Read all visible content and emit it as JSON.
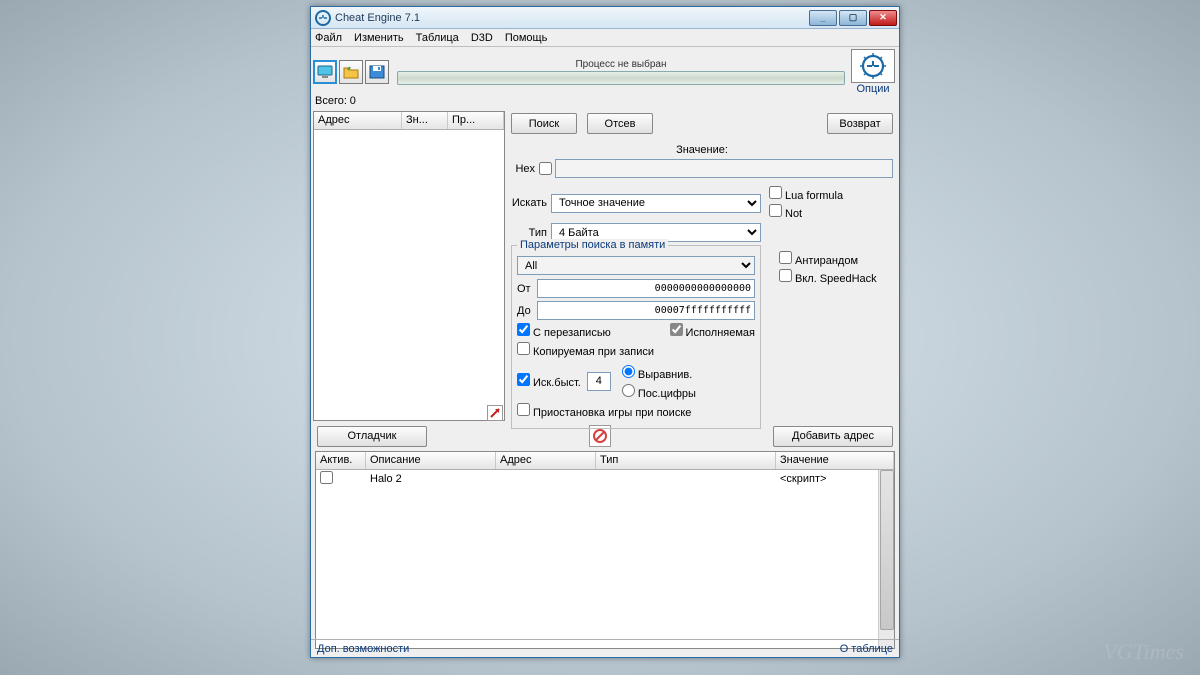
{
  "titlebar": {
    "title": "Cheat Engine 7.1"
  },
  "menu": {
    "file": "Файл",
    "edit": "Изменить",
    "table": "Таблица",
    "d3d": "D3D",
    "help": "Помощь"
  },
  "toolbar": {
    "process_status": "Процесс не выбран",
    "options": "Опции",
    "total_label": "Всего:",
    "total_count": "0"
  },
  "left_cols": {
    "addr": "Адрес",
    "val": "Зн...",
    "prev": "Пр..."
  },
  "buttons": {
    "search": "Поиск",
    "filter": "Отсев",
    "undo": "Возврат",
    "debugger": "Отладчик",
    "add_addr": "Добавить адрес"
  },
  "labels": {
    "value": "Значение:",
    "hex": "Hex",
    "search_for": "Искать",
    "type": "Тип",
    "from": "От",
    "to": "До"
  },
  "scan": {
    "type_value": "Точное значение",
    "value_type": "4 Байта",
    "lua": "Lua formula",
    "not": "Not",
    "group_title": "Параметры поиска в памяти",
    "region": "All",
    "from_val": "0000000000000000",
    "to_val": "00007fffffffffff",
    "writable": "С перезаписью",
    "executable": "Исполняемая",
    "cow": "Копируемая при записи",
    "fast": "Иск.быст.",
    "fast_val": "4",
    "align": "Выравнив.",
    "lastdig": "Пос.цифры",
    "pause": "Приостановка игры при поиске",
    "antirandom": "Антирандом",
    "speedhack": "Вкл. SpeedHack"
  },
  "table_head": {
    "active": "Актив.",
    "desc": "Описание",
    "addr": "Адрес",
    "type": "Тип",
    "value": "Значение"
  },
  "entries": [
    {
      "desc": "Halo 2",
      "value": "<скрипт>"
    }
  ],
  "status": {
    "left": "Доп. возможности",
    "right": "О таблице"
  },
  "watermark": "VGTimes"
}
